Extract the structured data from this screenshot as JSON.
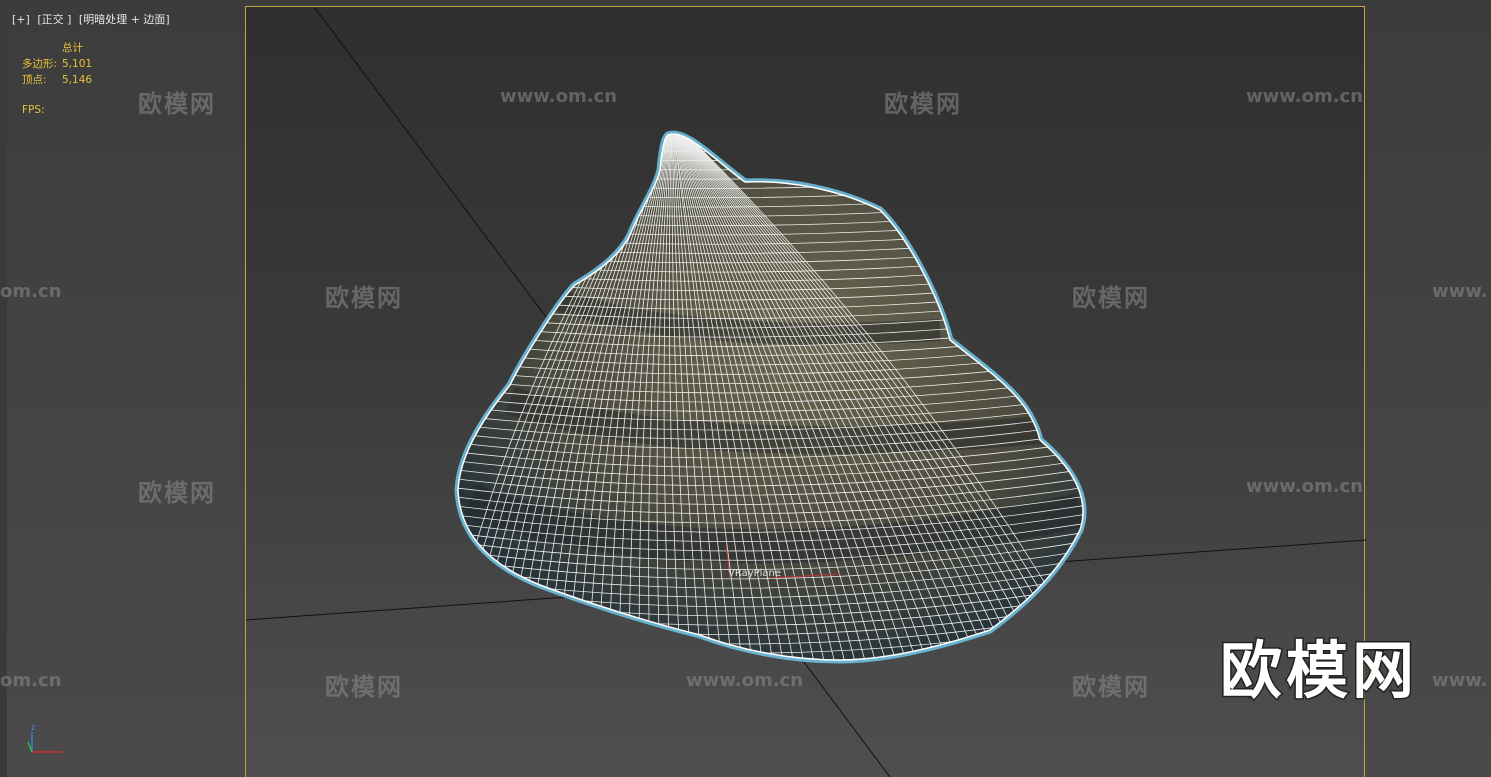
{
  "viewport": {
    "label_plus": "[+]",
    "label_view": "[正交 ]",
    "label_shading": "[明暗处理 + 边面]"
  },
  "stats": {
    "total_header": "总计",
    "polygons_label": "多边形:",
    "polygons_value": "5,101",
    "vertices_label": "顶点:",
    "vertices_value": "5,146",
    "fps_label": "FPS:"
  },
  "scene": {
    "object_label": "VRayPlane",
    "mesh_color": "#5d5a49",
    "wire_color": "#ffffff",
    "selection_color": "#6fc4e8"
  },
  "watermarks": {
    "cn": "欧模网",
    "url": "www.om.cn",
    "url_partial": "om.cn",
    "url_prefix": "www."
  },
  "axis": {
    "z_label": "z"
  }
}
